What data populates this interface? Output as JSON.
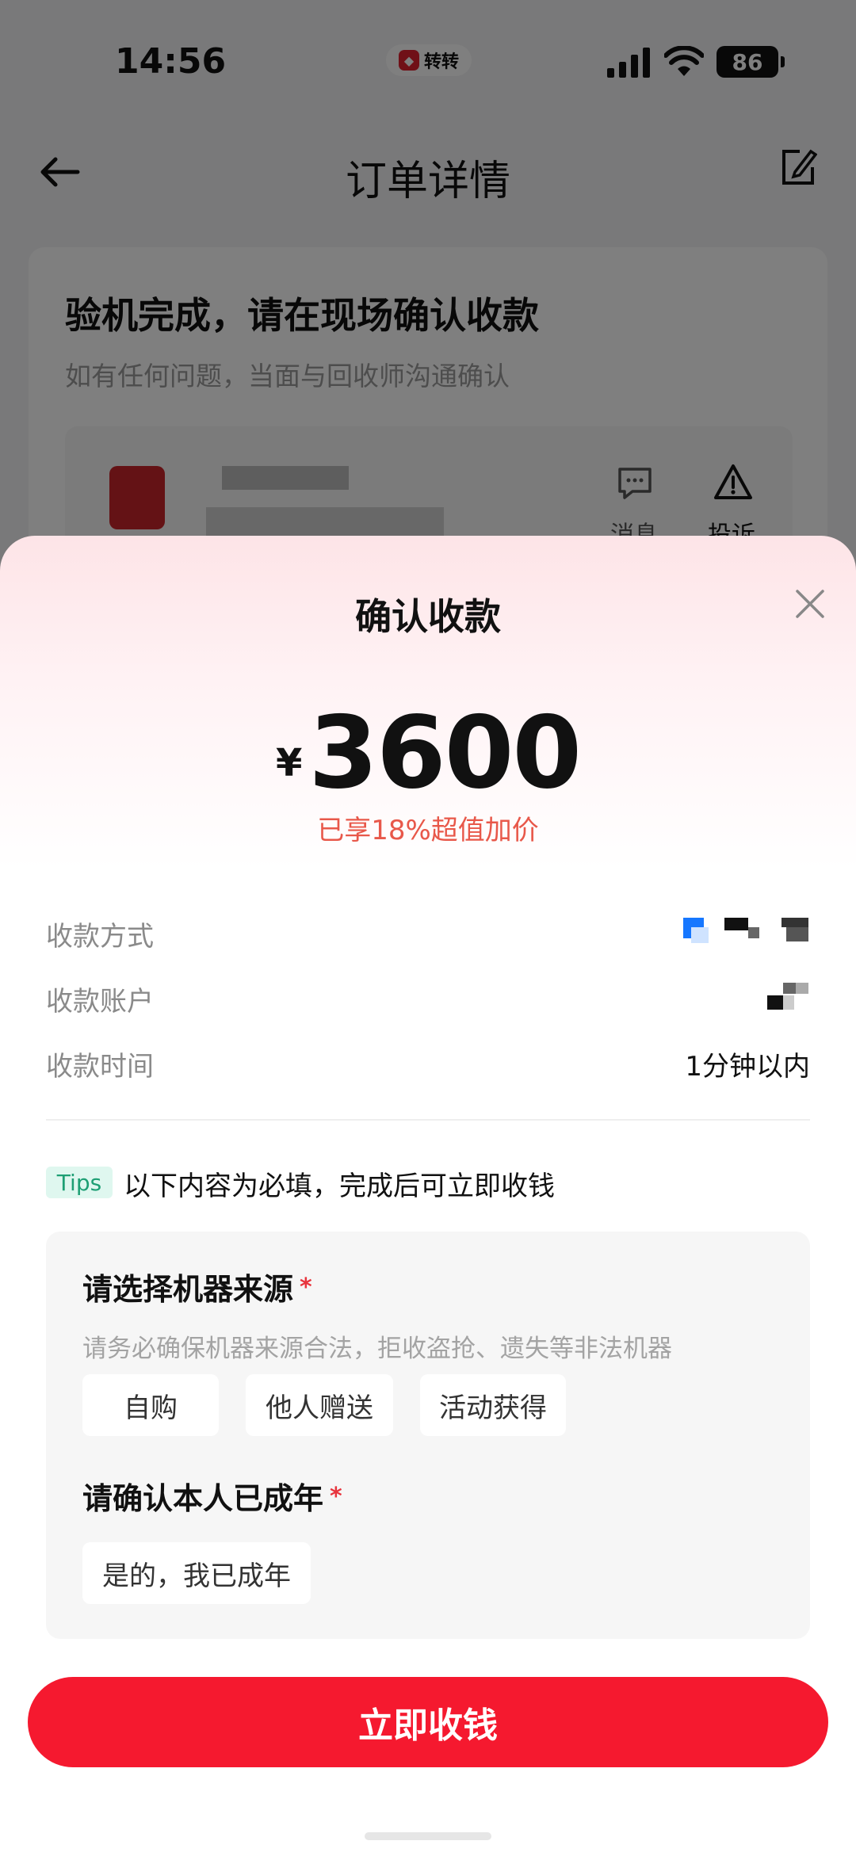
{
  "status_bar": {
    "time": "14:56",
    "app_badge": "转转",
    "battery": "86"
  },
  "header": {
    "title": "订单详情",
    "back_icon": "arrow-left-icon",
    "edit_icon": "edit-note-icon"
  },
  "order": {
    "heading": "验机完成，请在现场确认收款",
    "subheading": "如有任何问题，当面与回收师沟通确认",
    "actions": [
      {
        "label": "消息",
        "icon": "message-icon"
      },
      {
        "label": "投诉",
        "icon": "warning-icon"
      }
    ]
  },
  "sheet": {
    "title": "确认收款",
    "currency": "¥",
    "amount": "3600",
    "bonus": "已享18%超值加价",
    "info": [
      {
        "label": "收款方式",
        "value": ""
      },
      {
        "label": "收款账户",
        "value": ""
      },
      {
        "label": "收款时间",
        "value": "1分钟以内"
      }
    ],
    "tips_badge": "Tips",
    "tips_text": "以下内容为必填，完成后可立即收钱",
    "question1": {
      "title": "请选择机器来源",
      "required": "*",
      "hint": "请务必确保机器来源合法，拒收盗抢、遗失等非法机器",
      "options": [
        "自购",
        "他人赠送",
        "活动获得"
      ]
    },
    "question2": {
      "title": "请确认本人已成年",
      "required": "*",
      "options": [
        "是的，我已成年"
      ]
    },
    "submit": "立即收钱"
  },
  "colors": {
    "accent": "#f5192f",
    "bonus_text": "#e8584a",
    "tips_bg": "#dff7ef",
    "tips_fg": "#1e9f74"
  }
}
